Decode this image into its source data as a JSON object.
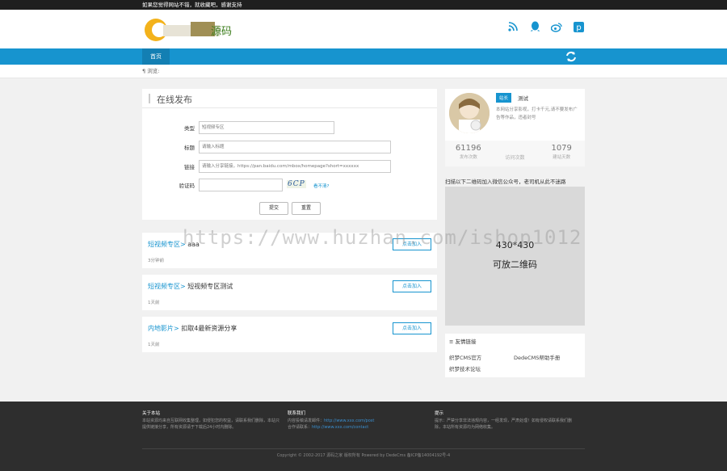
{
  "topbar": {
    "notice": "如果您觉得网站不错，就收藏吧，感谢支持"
  },
  "header": {
    "logo_text": "源码",
    "social": [
      "rss-icon",
      "qq-icon",
      "weibo-icon",
      "pinterest-icon"
    ]
  },
  "nav": {
    "home_label": "首页"
  },
  "breadcrumb": {
    "text": "浏览:"
  },
  "publish": {
    "title": "在线发布",
    "fields": {
      "type_label": "类型",
      "type_value": "短视频专区",
      "title_label": "标题",
      "title_placeholder": "请输入标题",
      "link_label": "链接",
      "link_placeholder": "请输入分享链接，https://pan.baidu.com/mbox/homepage?short=xxxxxx",
      "captcha_label": "验证码",
      "captcha_image_text": "6CP",
      "captcha_refresh": "看不清?"
    },
    "submit_label": "提交",
    "reset_label": "重置"
  },
  "posts": [
    {
      "category": "短视频专区>",
      "title": "aaa",
      "time": "3分钟前",
      "action": "点击加入"
    },
    {
      "category": "短视频专区>",
      "title": "短视频专区测试",
      "time": "1天前",
      "action": "点击加入"
    },
    {
      "category": "内地影片>",
      "title": "扣取4最新资源分享",
      "time": "1天前",
      "action": "点击加入"
    }
  ],
  "profile": {
    "tag": "站长",
    "name": "测试",
    "intro": "本网站分享影视，打卡千元,请不要发布广告等作品，违者封号",
    "stats": [
      {
        "value": "61196",
        "label": "发布次数"
      },
      {
        "value": "访问次数",
        "label": ""
      },
      {
        "value": "1079",
        "label": "建站天数"
      }
    ]
  },
  "qr": {
    "caption": "扫描以下二维码加入微信公众号，老司机从此不迷路",
    "size_text": "430*430",
    "placeholder_text": "可放二维码"
  },
  "links": {
    "heading": "友情链接",
    "items": [
      "织梦CMS官方",
      "DedeCMS帮助手册",
      "织梦技术论坛"
    ]
  },
  "footer": {
    "about_heading": "关于本站",
    "about_text": "本站资源均来自互联网收集整理，如侵犯您的权益，请联系我们删除，本站只提供链接分享，所有资源请于下载后24小时内删除。",
    "contact_heading": "联系我们",
    "contact_line1": "内容投稿请发邮件：",
    "contact_link1": "http://www.xxx.com/post",
    "contact_line2": "合作请联系：",
    "contact_link2": "http://www.xxx.com/contact",
    "tips_heading": "提示",
    "tips_text": "提示：严禁分享非法违规内容，一经发现，严肃处理！如有侵权请联系我们删除，本站所有资源均为网络收集。",
    "copyright": "Copyright © 2002-2017 源码之家 版权所有 Powered by DedeCms 备ICP备14004192号-4"
  },
  "watermark": "https://www.huzhan.com/ishop1012"
}
